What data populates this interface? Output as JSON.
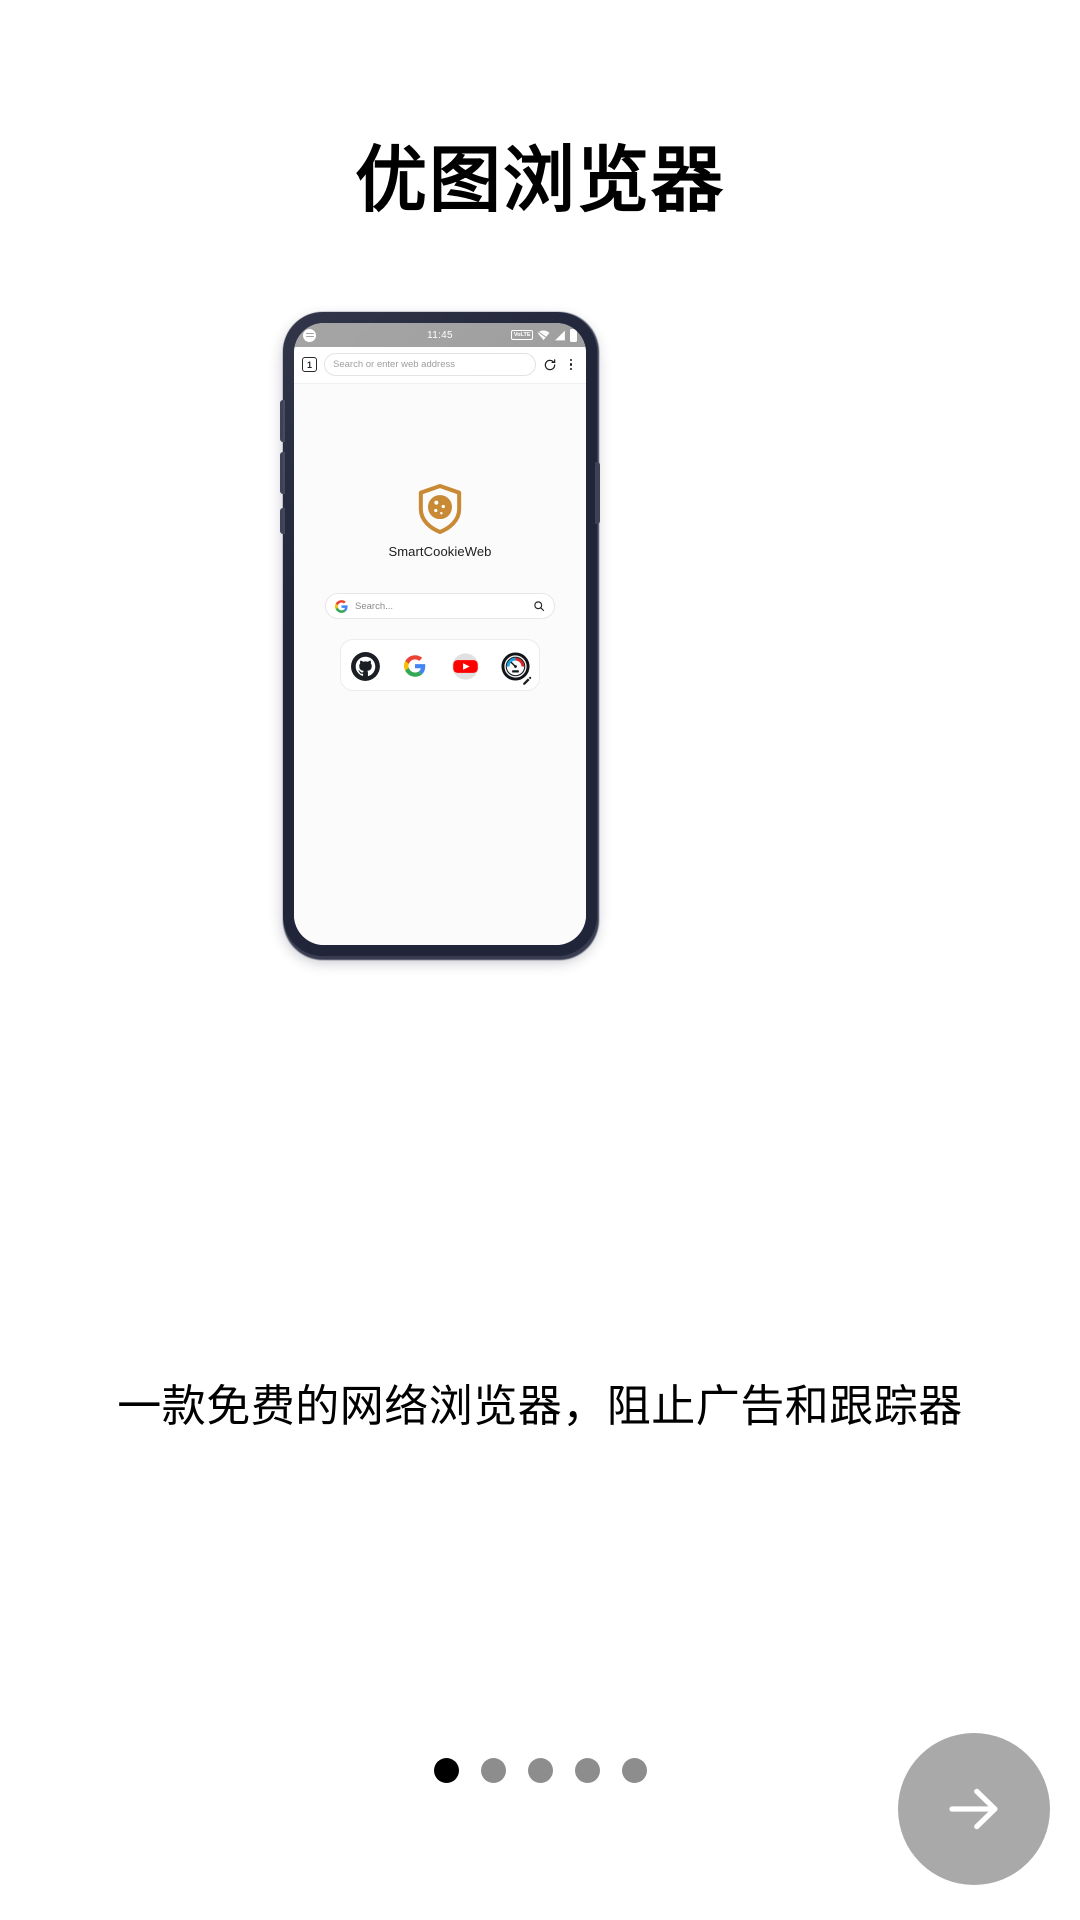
{
  "page": {
    "headline": "优图浏览器",
    "subtitle": "一款免费的网络浏览器，阻止广告和跟踪器",
    "background_color": "#ffffff",
    "text_color": "#000000"
  },
  "phone": {
    "frame_color": "#21253a",
    "frame_highlight_color": "#3d4257",
    "screen_background": "#fbfbfb"
  },
  "status_bar": {
    "time": "11:45",
    "app_icon": "notification-icon",
    "volte_label": "VoLTE",
    "wifi_icon": "wifi-icon",
    "signal_icon": "cellular-signal-icon",
    "battery_icon": "battery-icon",
    "background_color": "#9e9e9e"
  },
  "browser": {
    "tab_count": "1",
    "url_placeholder": "Search or enter web address",
    "url_value": "",
    "reload_icon": "reload-icon",
    "menu_icon": "overflow-menu-icon"
  },
  "new_tab_page": {
    "brand_name": "SmartCookieWeb",
    "logo_icon": "cookie-shield-logo",
    "logo_color": "#c88a34",
    "search": {
      "engine_icon": "google-g-icon",
      "placeholder": "Search...",
      "value": "",
      "submit_icon": "magnifier-icon"
    },
    "shortcuts": [
      {
        "name": "github-shortcut",
        "icon": "github-icon"
      },
      {
        "name": "google-shortcut",
        "icon": "google-g-icon"
      },
      {
        "name": "youtube-shortcut",
        "icon": "youtube-icon"
      },
      {
        "name": "speedtest-shortcut",
        "icon": "speedometer-icon"
      }
    ],
    "edit_icon": "pencil-edit-icon"
  },
  "pagination": {
    "total": 5,
    "active_index": 0,
    "active_color": "#000000",
    "inactive_color": "#8d8d8d"
  },
  "next_button": {
    "icon": "arrow-right-icon",
    "label": "",
    "background_color": "#a9a9a9",
    "icon_color": "#ffffff"
  }
}
